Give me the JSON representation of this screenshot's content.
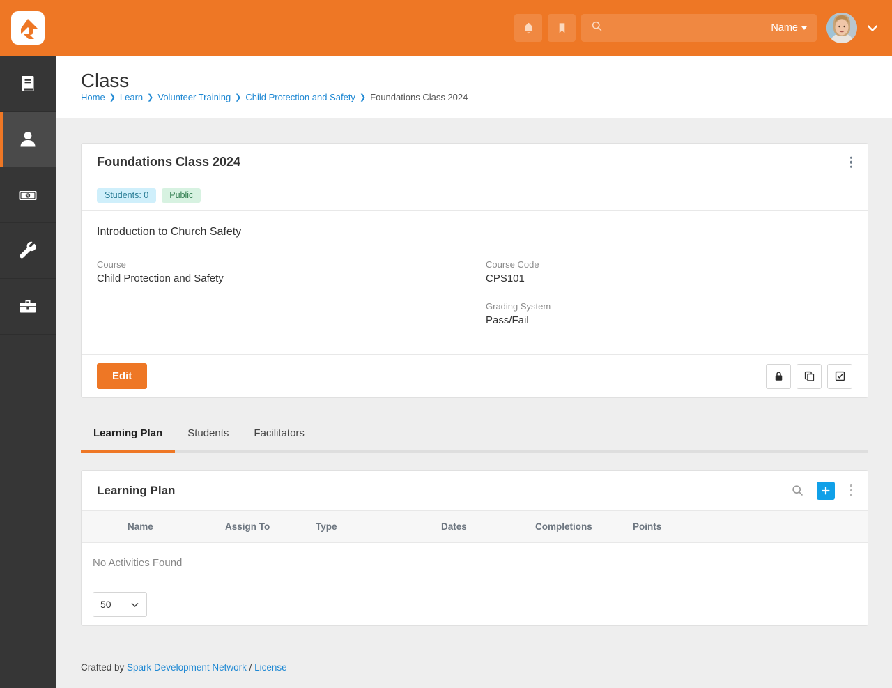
{
  "topbar": {
    "logo": "rock-logo",
    "notifications_icon": "bell-icon",
    "bookmarks_icon": "bookmark-icon",
    "search_icon": "search-icon",
    "search_placeholder": "",
    "search_value": "",
    "search_scope_label": "Name",
    "avatar": "user-avatar",
    "accent_color": "#ee7725"
  },
  "sidebar": {
    "items": [
      {
        "icon": "book-icon",
        "active": false
      },
      {
        "icon": "person-icon",
        "active": true
      },
      {
        "icon": "money-bill-icon",
        "active": false
      },
      {
        "icon": "wrench-icon",
        "active": false
      },
      {
        "icon": "toolbox-icon",
        "active": false
      }
    ]
  },
  "page": {
    "title": "Class",
    "breadcrumb": [
      {
        "label": "Home",
        "link": true
      },
      {
        "label": "Learn",
        "link": true
      },
      {
        "label": "Volunteer Training",
        "link": true
      },
      {
        "label": "Child Protection and Safety",
        "link": true
      },
      {
        "label": "Foundations Class 2024",
        "link": false
      }
    ]
  },
  "class_card": {
    "title": "Foundations Class 2024",
    "menu_icon": "kebab-menu-icon",
    "badges": [
      {
        "label": "Students: 0",
        "style": "info"
      },
      {
        "label": "Public",
        "style": "success"
      }
    ],
    "description": "Introduction to Church Safety",
    "fields_left": [
      {
        "label": "Course",
        "value": "Child Protection and Safety"
      }
    ],
    "fields_right": [
      {
        "label": "Course Code",
        "value": "CPS101"
      },
      {
        "label": "Grading System",
        "value": "Pass/Fail"
      }
    ],
    "edit_label": "Edit",
    "actions": [
      {
        "icon": "lock-icon"
      },
      {
        "icon": "copy-icon"
      },
      {
        "icon": "check-square-icon"
      }
    ]
  },
  "tabs": [
    {
      "label": "Learning Plan",
      "active": true
    },
    {
      "label": "Students",
      "active": false
    },
    {
      "label": "Facilitators",
      "active": false
    }
  ],
  "learning_plan": {
    "title": "Learning Plan",
    "search_icon": "search-icon",
    "add_icon": "plus-icon",
    "menu_icon": "kebab-menu-icon",
    "columns": [
      "Name",
      "Assign To",
      "Type",
      "Dates",
      "Completions",
      "Points"
    ],
    "rows": [],
    "empty_message": "No Activities Found",
    "page_size": "50"
  },
  "footer": {
    "prefix": "Crafted by ",
    "org": "Spark Development Network",
    "separator": " / ",
    "license": "License"
  }
}
